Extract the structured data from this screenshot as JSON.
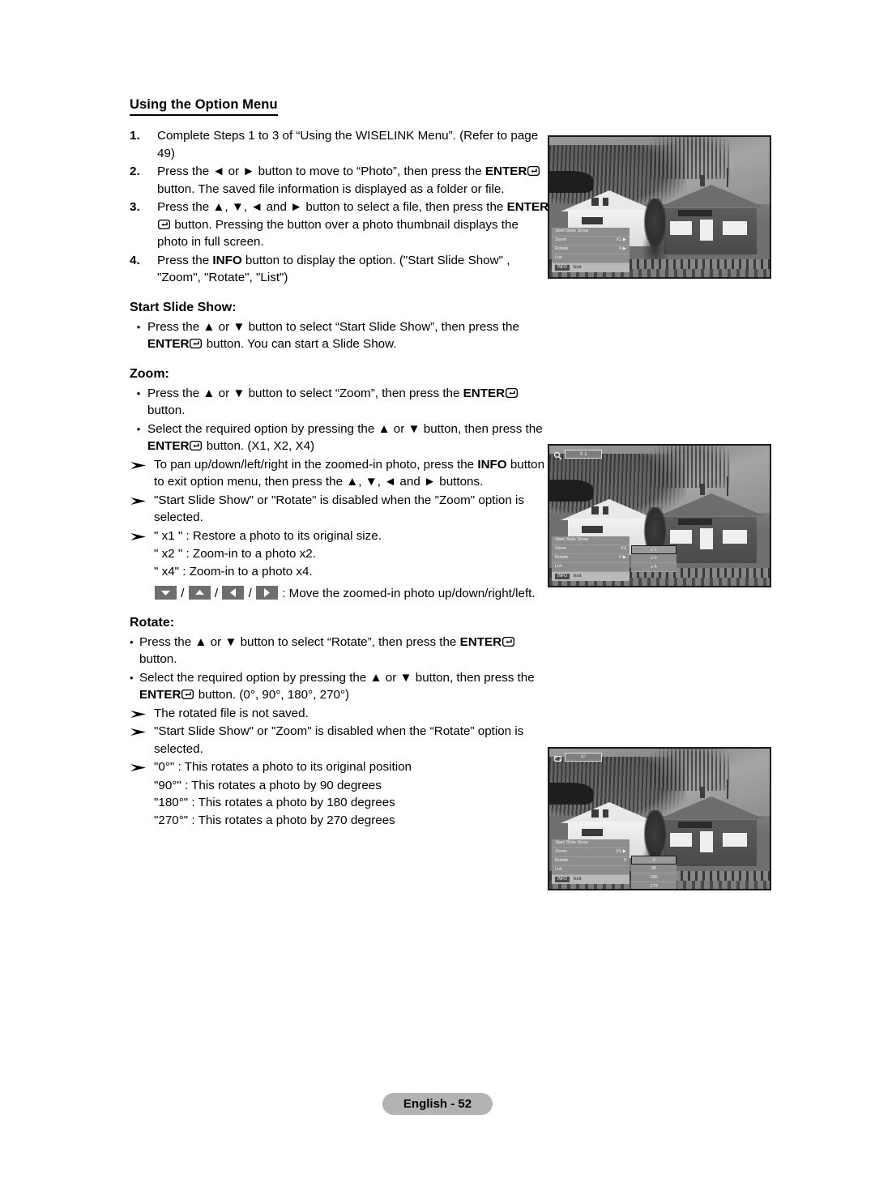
{
  "heading": "Using the Option Menu",
  "steps": [
    {
      "num": "1.",
      "parts": [
        {
          "t": "text",
          "v": "Complete Steps 1 to 3 of “Using the WISELINK Menu”. (Refer to page 49)"
        }
      ]
    },
    {
      "num": "2.",
      "parts": [
        {
          "t": "text",
          "v": "Press the ◄ or ► button to move to “Photo”, then press the "
        },
        {
          "t": "bold",
          "v": "ENTER"
        },
        {
          "t": "enter",
          "v": ""
        },
        {
          "t": "text",
          "v": " button. The saved file information is displayed as a folder or file."
        }
      ]
    },
    {
      "num": "3.",
      "parts": [
        {
          "t": "text",
          "v": "Press the ▲, ▼, ◄ and ► button to select a file, then press the "
        },
        {
          "t": "bold",
          "v": "ENTER"
        },
        {
          "t": "enter",
          "v": ""
        },
        {
          "t": "text",
          "v": " button. Pressing the button over a photo thumbnail displays the photo in full screen."
        }
      ]
    },
    {
      "num": "4.",
      "parts": [
        {
          "t": "text",
          "v": "Press the "
        },
        {
          "t": "bold",
          "v": "INFO"
        },
        {
          "t": "text",
          "v": " button to display the option. (\"Start Slide Show\" , \"Zoom\", \"Rotate\", \"List\")"
        }
      ]
    }
  ],
  "slideshow": {
    "title": "Start Slide Show:",
    "bullets": [
      {
        "marker": "•",
        "parts": [
          {
            "t": "text",
            "v": "Press the ▲ or ▼ button to select “Start Slide Show”, then press the "
          },
          {
            "t": "bold",
            "v": "ENTER"
          },
          {
            "t": "enter",
            "v": ""
          },
          {
            "t": "text",
            "v": " button. You can start a Slide Show."
          }
        ]
      }
    ]
  },
  "zoom": {
    "title": "Zoom:",
    "bullets": [
      {
        "marker": "•",
        "parts": [
          {
            "t": "text",
            "v": "Press the ▲ or ▼ button to select “Zoom”, then press the "
          },
          {
            "t": "bold",
            "v": "ENTER"
          },
          {
            "t": "enter",
            "v": ""
          },
          {
            "t": "text",
            "v": " button."
          }
        ]
      },
      {
        "marker": "•",
        "parts": [
          {
            "t": "text",
            "v": "Select the required option by pressing the ▲ or ▼ button, then press the "
          },
          {
            "t": "bold",
            "v": "ENTER"
          },
          {
            "t": "enter",
            "v": ""
          },
          {
            "t": "text",
            "v": " button. (X1, X2, X4)"
          }
        ]
      }
    ],
    "notes": [
      {
        "parts": [
          {
            "t": "text",
            "v": "To pan up/down/left/right in the zoomed-in photo, press the "
          },
          {
            "t": "bold",
            "v": "INFO"
          },
          {
            "t": "text",
            "v": " button to exit option menu, then press the ▲, ▼, ◄ and ► buttons."
          }
        ]
      },
      {
        "parts": [
          {
            "t": "text",
            "v": "\"Start Slide Show\" or \"Rotate\" is disabled when the \"Zoom\" option is selected."
          }
        ]
      },
      {
        "parts": [
          {
            "t": "text",
            "v": "\" x1 \" : Restore a photo to its original size."
          }
        ]
      }
    ],
    "plain_lines": [
      "\" x2 \" : Zoom-in to a photo x2.",
      "\" x4\"  : Zoom-in to a photo x4."
    ],
    "keys_line": {
      "keys": [
        "down-arrow-key",
        "up-arrow-key",
        "left-arrow-key",
        "right-arrow-key"
      ],
      "separator": " / ",
      "text": " : Move the zoomed-in photo up/down/right/left."
    }
  },
  "rotate": {
    "title": "Rotate:",
    "bullets": [
      {
        "marker": "•",
        "parts": [
          {
            "t": "text",
            "v": "Press the ▲ or ▼ button to select “Rotate”, then press the "
          },
          {
            "t": "bold",
            "v": "ENTER"
          },
          {
            "t": "enter",
            "v": ""
          },
          {
            "t": "text",
            "v": " button."
          }
        ]
      },
      {
        "marker": "•",
        "parts": [
          {
            "t": "text",
            "v": "Select the required option by pressing the ▲ or ▼ button, then press the "
          },
          {
            "t": "bold",
            "v": "ENTER"
          },
          {
            "t": "enter",
            "v": ""
          },
          {
            "t": "text",
            "v": " button. (0°, 90°, 180°, 270°)"
          }
        ]
      }
    ],
    "notes": [
      {
        "parts": [
          {
            "t": "text",
            "v": "The rotated file is not saved."
          }
        ]
      },
      {
        "parts": [
          {
            "t": "text",
            "v": "\"Start Slide Show\" or \"Zoom\" is disabled when the “Rotate” option is selected."
          }
        ]
      },
      {
        "parts": [
          {
            "t": "text",
            "v": "\"0°\" : This rotates a photo to its original position"
          }
        ]
      }
    ],
    "plain_lines": [
      "\"90°\" : This rotates a photo by 90 degrees",
      "\"180°\" : This rotates a photo by 180 degrees",
      "\"270°\" : This rotates a photo by 270 degrees"
    ]
  },
  "screens": {
    "option_menu": {
      "caption_name": "tv-screenshot-option-menu",
      "rows": [
        {
          "label": "Start Slide Show",
          "value": ""
        },
        {
          "label": "Zoom",
          "value": "X1 ▶"
        },
        {
          "label": "Rotate",
          "value": "0 ▶"
        },
        {
          "label": "List",
          "value": ""
        }
      ],
      "footer": {
        "info": "INFO",
        "exit": "Exit"
      }
    },
    "zoom_menu": {
      "caption_name": "tv-screenshot-zoom-menu",
      "badge": {
        "icon": "magnifier-icon",
        "value": "X 1"
      },
      "rows": [
        {
          "label": "Start Slide Show",
          "value": ""
        },
        {
          "label": "Zoom",
          "value": "X1"
        },
        {
          "label": "Rotate",
          "value": "0 ▶"
        },
        {
          "label": "List",
          "value": ""
        }
      ],
      "footer": {
        "info": "INFO",
        "exit": "Exit"
      },
      "submenu": {
        "options": [
          "x 1",
          "x 2",
          "x 4"
        ],
        "selected_index": 0
      }
    },
    "rotate_menu": {
      "caption_name": "tv-screenshot-rotate-menu",
      "badge": {
        "icon": "rotate-icon",
        "value": "0°"
      },
      "rows": [
        {
          "label": "Start Slide Show",
          "value": ""
        },
        {
          "label": "Zoom",
          "value": "X1 ▶"
        },
        {
          "label": "Rotate",
          "value": "0"
        },
        {
          "label": "List",
          "value": ""
        }
      ],
      "footer": {
        "info": "INFO",
        "exit": "Exit"
      },
      "submenu": {
        "options": [
          "0",
          "90",
          "180",
          "270"
        ],
        "selected_index": 0
      }
    }
  },
  "footer": {
    "page_label": "English - 52"
  },
  "colors": {
    "page_bg": "#ffffff",
    "text": "#000000",
    "footer_pill": "#b3b3b3",
    "osd_row": "#8d8d8d",
    "osd_footer": "#b9b9b9",
    "key_button": "#6e6e6e"
  }
}
